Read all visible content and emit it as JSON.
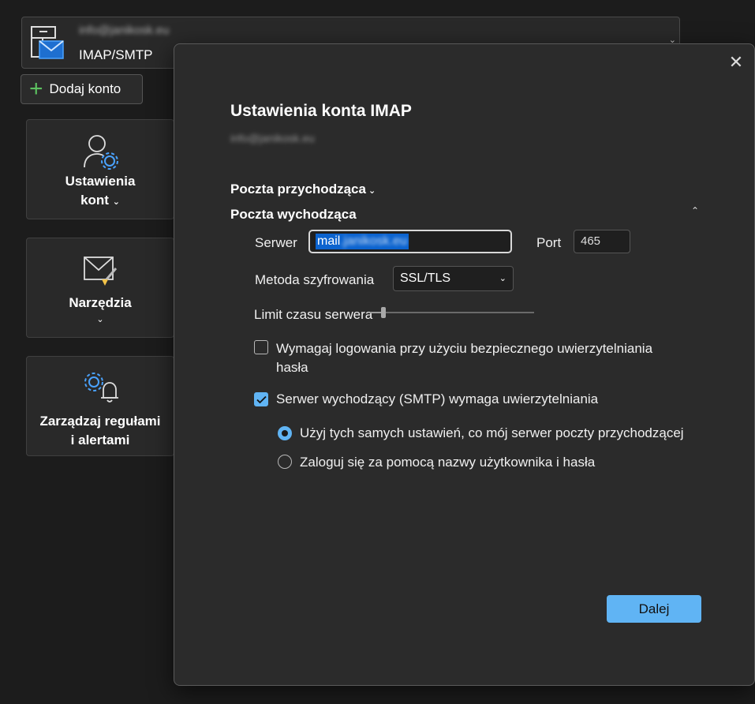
{
  "account": {
    "email": "info@janikosk.eu",
    "type": "IMAP/SMTP"
  },
  "add_account": {
    "label": "Dodaj konto"
  },
  "tiles": {
    "account_settings": {
      "label_line1": "Ustawienia",
      "label_line2": "kont"
    },
    "tools": {
      "label": "Narzędzia"
    },
    "rules": {
      "label_line1": "Zarządzaj regułami",
      "label_line2": "i alertami"
    }
  },
  "dialog": {
    "title": "Ustawienia konta IMAP",
    "subtitle": "info@janikosk.eu",
    "incoming_section": "Poczta przychodząca",
    "outgoing_section": "Poczta wychodząca",
    "server_label": "Serwer",
    "server_value_prefix": "mail",
    "server_value_rest": ".janikosk.eu",
    "port_label": "Port",
    "port_value": "465",
    "encryption_label": "Metoda szyfrowania",
    "encryption_value": "SSL/TLS",
    "timeout_label": "Limit czasu serwera",
    "timeout_level": 0.2,
    "spa_label_line1": "Wymagaj logowania przy użyciu bezpiecznego uwierzytelniania",
    "spa_label_line2": "hasła",
    "spa_checked": false,
    "smtp_auth_label": "Serwer wychodzący (SMTP) wymaga uwierzytelniania",
    "smtp_auth_checked": true,
    "option_same": "Użyj tych samych ustawień, co mój serwer poczty przychodzącej",
    "option_login": "Zaloguj się za pomocą nazwy użytkownika i hasła",
    "selected_option": "same",
    "next_label": "Dalej"
  },
  "colors": {
    "accent": "#60b4f4",
    "selection": "#0b63cf",
    "background": "#1c1c1c",
    "dialog": "#2b2b2b"
  }
}
